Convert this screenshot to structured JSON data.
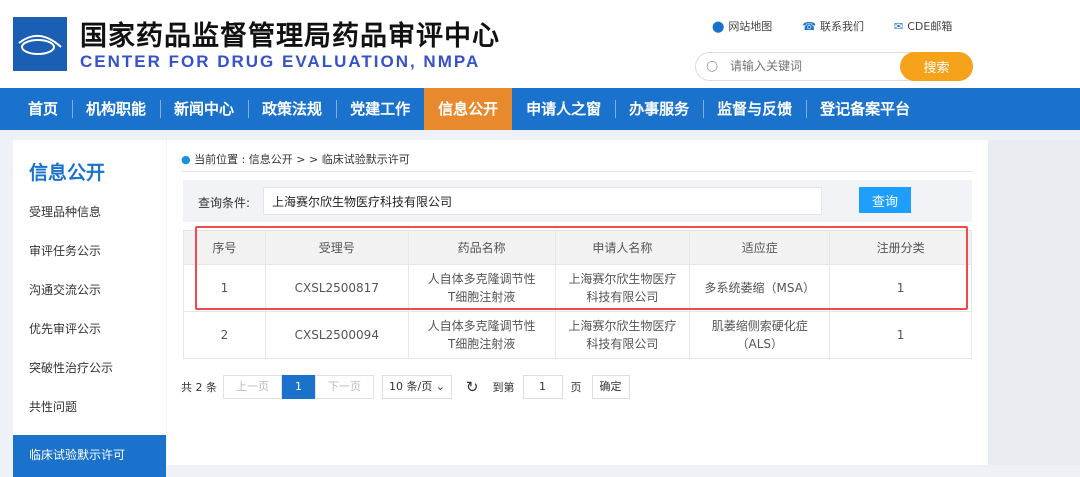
{
  "header": {
    "title_cn": "国家药品监督管理局药品审评中心",
    "title_en": "CENTER FOR DRUG EVALUATION, NMPA",
    "links": [
      {
        "icon": "map-pin-icon",
        "label": "网站地图"
      },
      {
        "icon": "phone-icon",
        "label": "联系我们"
      },
      {
        "icon": "mail-icon",
        "label": "CDE邮箱"
      }
    ],
    "search_placeholder": "请输入关键词",
    "search_button": "搜索"
  },
  "nav": [
    "首页",
    "机构职能",
    "新闻中心",
    "政策法规",
    "党建工作",
    "信息公开",
    "申请人之窗",
    "办事服务",
    "监督与反馈",
    "登记备案平台"
  ],
  "nav_active": "信息公开",
  "sidebar": {
    "title": "信息公开",
    "items": [
      "受理品种信息",
      "审评任务公示",
      "沟通交流公示",
      "优先审评公示",
      "突破性治疗公示",
      "共性问题",
      "临床试验默示许可"
    ],
    "active": "临床试验默示许可"
  },
  "breadcrumb": {
    "prefix": "当前位置 : 信息公开 > > ",
    "current": "临床试验默示许可"
  },
  "query": {
    "label": "查询条件:",
    "value": "上海赛尔欣生物医疗科技有限公司",
    "button": "查询"
  },
  "table": {
    "headers": [
      "序号",
      "受理号",
      "药品名称",
      "申请人名称",
      "适应症",
      "注册分类"
    ],
    "rows": [
      [
        "1",
        "CXSL2500817",
        "人自体多克隆调节性T细胞注射液",
        "上海赛尔欣生物医疗科技有限公司",
        "多系统萎缩（MSA）",
        "1"
      ],
      [
        "2",
        "CXSL2500094",
        "人自体多克隆调节性T细胞注射液",
        "上海赛尔欣生物医疗科技有限公司",
        "肌萎缩侧索硬化症（ALS）",
        "1"
      ]
    ]
  },
  "pager": {
    "total": "共 2 条",
    "prev": "上一页",
    "current": "1",
    "next": "下一页",
    "page_size": "10 条/页",
    "goto": "到第",
    "goto_value": "1",
    "page": "页",
    "confirm": "确定"
  },
  "colors": {
    "nav": "#1a72cc",
    "active": "#e8892e",
    "highlight": "#ee4b4b"
  }
}
